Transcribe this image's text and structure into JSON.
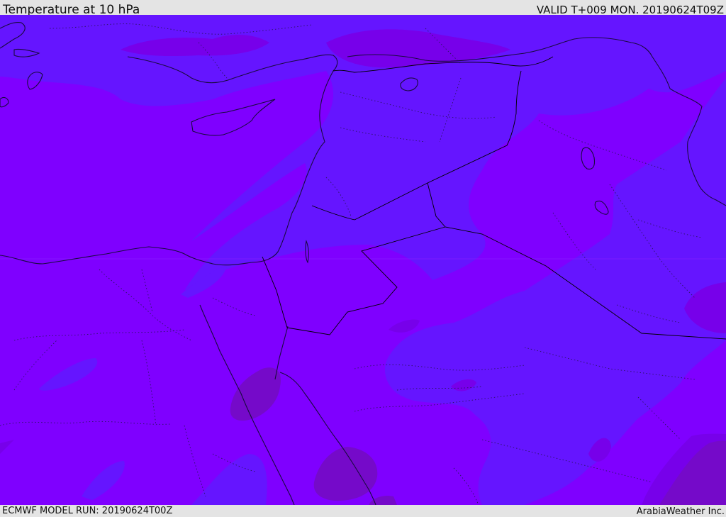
{
  "header": {
    "title": "Temperature at 10 hPa",
    "valid": "VALID T+009 MON. 20190624T09Z"
  },
  "footer": {
    "model_run": "ECMWF MODEL RUN: 20190624T00Z",
    "credit": "ArabiaWeather Inc."
  },
  "map": {
    "colors": {
      "background_fill": "#7f00ff",
      "cooler_band_fill": "#6515ff",
      "warmer_patch_fill": "#7700ea",
      "darkest_patch_fill": "#750ac9",
      "coastline": "#1a0a40",
      "border_dotted": "#2a1460"
    }
  }
}
